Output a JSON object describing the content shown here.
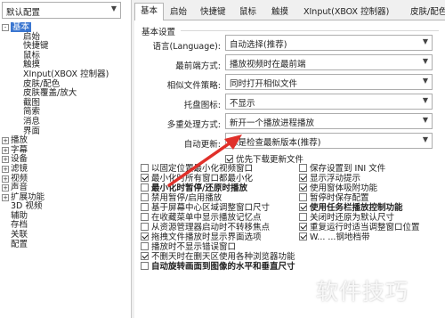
{
  "profile": {
    "value": "默认配置"
  },
  "tree": [
    {
      "label": "基本",
      "level": 0,
      "toggle": "-",
      "selected": true
    },
    {
      "label": "启始",
      "level": 1
    },
    {
      "label": "快捷键",
      "level": 1
    },
    {
      "label": "鼠标",
      "level": 1
    },
    {
      "label": "触摸",
      "level": 1
    },
    {
      "label": "XInput(XBOX 控制器)",
      "level": 1
    },
    {
      "label": "皮肤/配色",
      "level": 1
    },
    {
      "label": "皮肤覆盖/放大",
      "level": 1
    },
    {
      "label": "截图",
      "level": 1
    },
    {
      "label": "简索",
      "level": 1
    },
    {
      "label": "消息",
      "level": 1
    },
    {
      "label": "界面",
      "level": 1
    },
    {
      "label": "播放",
      "level": 0,
      "toggle": "+"
    },
    {
      "label": "字幕",
      "level": 0,
      "toggle": "+"
    },
    {
      "label": "设备",
      "level": 0,
      "toggle": "+"
    },
    {
      "label": "滤镜",
      "level": 0,
      "toggle": "+"
    },
    {
      "label": "视频",
      "level": 0,
      "toggle": "+"
    },
    {
      "label": "声音",
      "level": 0,
      "toggle": "+"
    },
    {
      "label": "扩展功能",
      "level": 0,
      "toggle": "+"
    },
    {
      "label": "3D 视频",
      "level": 0
    },
    {
      "label": "辅助",
      "level": 0
    },
    {
      "label": "存档",
      "level": 0
    },
    {
      "label": "关联",
      "level": 0
    },
    {
      "label": "配置",
      "level": 0
    }
  ],
  "tabs": [
    "基本",
    "启始",
    "快捷键",
    "鼠标",
    "触摸",
    "XInput(XBOX 控制器)",
    "皮肤/配色"
  ],
  "group_title": "基本设置",
  "form": [
    {
      "label": "语言(Language):",
      "value": "自动选择(推荐)"
    },
    {
      "label": "最前端方式:",
      "value": "播放视频时在最前端"
    },
    {
      "label": "相似文件策略:",
      "value": "同时打开相似文件"
    },
    {
      "label": "托盘图标:",
      "value": "不显示"
    },
    {
      "label": "多重处理方式:",
      "value": "新开一个播放进程播放"
    },
    {
      "label": "自动更新:",
      "value": "总是检查最新版本(推荐)"
    }
  ],
  "auto_update_check": {
    "label": "优先下载更新文件",
    "checked": true
  },
  "options_left": [
    {
      "label": "以固定位置最小化视频窗口",
      "checked": false,
      "bold": false
    },
    {
      "label": "最小化时所有窗口都最小化",
      "checked": true,
      "bold": false
    },
    {
      "label": "最小化时暂停/还原时播放",
      "checked": false,
      "bold": true
    },
    {
      "label": "禁用暂停/启用播放",
      "checked": false,
      "bold": false
    },
    {
      "label": "基于屏幕中心区域调整窗口尺寸",
      "checked": false,
      "bold": false
    },
    {
      "label": "在收藏菜单中显示播放记忆点",
      "checked": false,
      "bold": false
    },
    {
      "label": "从资源管理器启动时不转移焦点",
      "checked": false,
      "bold": false
    },
    {
      "label": "拖拽文件播放时显示界面选项",
      "checked": true,
      "bold": false
    },
    {
      "label": "播放时不显示错误窗口",
      "checked": false,
      "bold": false
    },
    {
      "label": "不删天时在删天区使用各种浏览器功能",
      "checked": true,
      "bold": false
    },
    {
      "label": "自动旋转画面到图像的水平和垂直尺寸",
      "checked": false,
      "bold": true
    }
  ],
  "options_right": [
    {
      "label": "保存设置到 INI 文件",
      "checked": false,
      "bold": false
    },
    {
      "label": "显示浮动提示",
      "checked": true,
      "bold": false
    },
    {
      "label": "使用窗体吸附功能",
      "checked": true,
      "bold": false
    },
    {
      "label": "暂停时保存配置",
      "checked": false,
      "bold": false
    },
    {
      "label": "使用任务栏播放控制功能",
      "checked": true,
      "bold": true
    },
    {
      "label": "关闭时还原为默认尺寸",
      "checked": false,
      "bold": false
    },
    {
      "label": "重复运行时适当调整窗口位置",
      "checked": true,
      "bold": false
    },
    {
      "label": "W...  ...钢地档带",
      "checked": true,
      "bold": false
    }
  ],
  "watermark": "软件技巧",
  "colors": {
    "selection": "#3a76d0",
    "arrow": "#e0302a"
  }
}
